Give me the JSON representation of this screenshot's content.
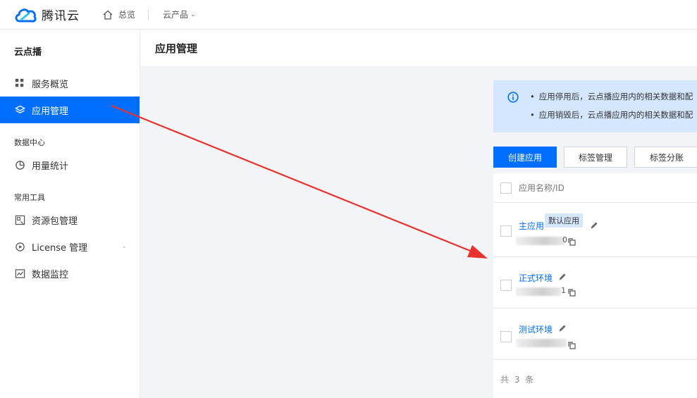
{
  "topbar": {
    "brand": "腾讯云",
    "home_label": "总览",
    "products_label": "云产品"
  },
  "sidebar": {
    "title": "云点播",
    "items": [
      {
        "label": "服务概览",
        "icon": "grid-icon"
      },
      {
        "label": "应用管理",
        "icon": "layers-icon",
        "active": true
      }
    ],
    "groups": [
      {
        "label": "数据中心",
        "items": [
          {
            "label": "用量统计",
            "icon": "pie-icon"
          }
        ]
      },
      {
        "label": "常用工具",
        "items": [
          {
            "label": "资源包管理",
            "icon": "package-icon"
          },
          {
            "label": "License 管理",
            "icon": "play-circle-icon",
            "expandable": true
          },
          {
            "label": "数据监控",
            "icon": "monitor-chart-icon"
          }
        ]
      }
    ]
  },
  "main": {
    "title": "应用管理",
    "notice": {
      "lines": [
        "应用停用后，云点播应用内的相关数据和配",
        "应用销毁后，云点播应用内的相关数据和配"
      ]
    },
    "buttons": {
      "create": "创建应用",
      "tag_manage": "标签管理",
      "tag_billing": "标签分账"
    },
    "table": {
      "header": "应用名称/ID",
      "rows": [
        {
          "name": "主应用",
          "tag": "默认应用",
          "id_tail": "0"
        },
        {
          "name": "正式环境",
          "tag": "",
          "id_tail": "1"
        },
        {
          "name": "测试环境",
          "tag": "",
          "id_tail": ""
        }
      ],
      "total": "共 3 条"
    }
  },
  "colors": {
    "primary": "#006eff",
    "notice_bg": "#d5e7ff",
    "arrow": "#e8322b"
  }
}
